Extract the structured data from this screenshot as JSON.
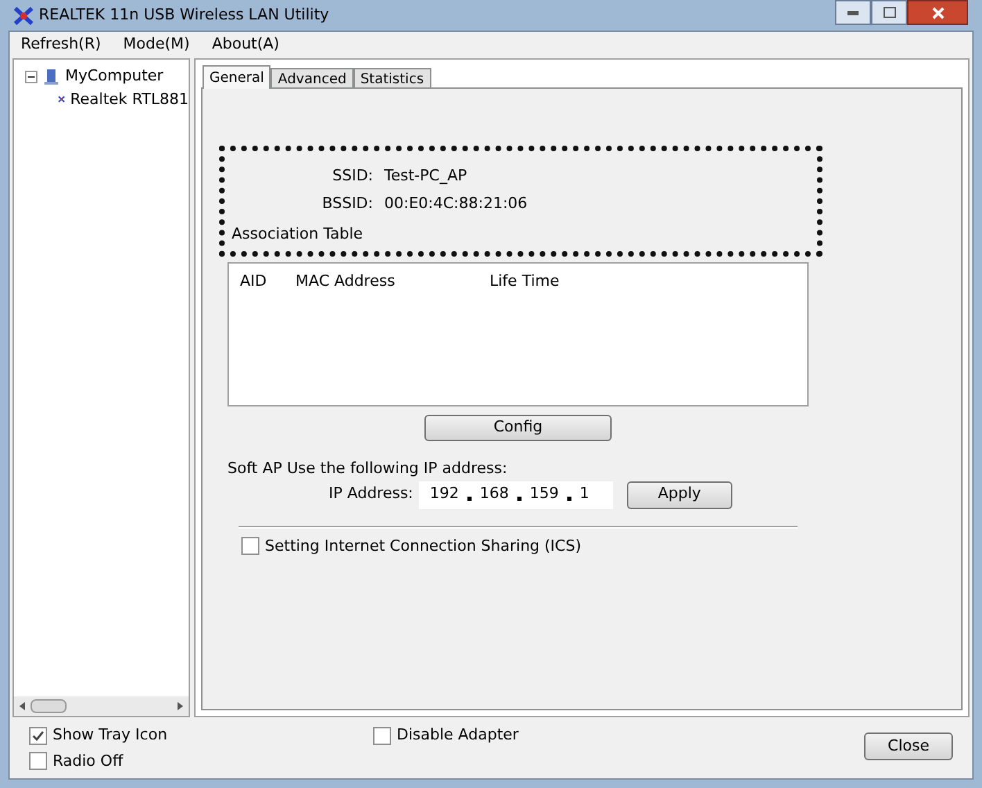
{
  "window": {
    "title": "REALTEK 11n USB Wireless LAN Utility"
  },
  "menu": [
    "Refresh(R)",
    "Mode(M)",
    "About(A)"
  ],
  "tree": [
    {
      "label": "MyComputer",
      "expanded": true,
      "children": [
        {
          "label": "Realtek RTL881"
        }
      ]
    }
  ],
  "tabs": [
    {
      "label": "General",
      "selected": true
    },
    {
      "label": "Advanced",
      "selected": false
    },
    {
      "label": "Statistics",
      "selected": false
    }
  ],
  "ssid": {
    "label": "SSID:",
    "value": "Test-PC_AP"
  },
  "bssid": {
    "label": "BSSID:",
    "value": "00:E0:4C:88:21:06"
  },
  "association_table": {
    "title": "Association Table",
    "columns": [
      "AID",
      "MAC Address",
      "Life Time"
    ]
  },
  "config_button": "Config",
  "soft_ap": {
    "heading": "Soft AP Use the following IP address:",
    "ip_label": "IP Address:",
    "ip_octets": [
      "192",
      "168",
      "159",
      "1"
    ],
    "apply_button": "Apply"
  },
  "ics": {
    "label": "Setting Internet Connection Sharing (ICS)",
    "checked": false
  },
  "bottom": [
    {
      "label": "Show Tray Icon",
      "checked": true
    },
    {
      "label": "Radio Off",
      "checked": false
    },
    {
      "label": "Disable Adapter",
      "checked": false
    }
  ],
  "close_button": "Close"
}
